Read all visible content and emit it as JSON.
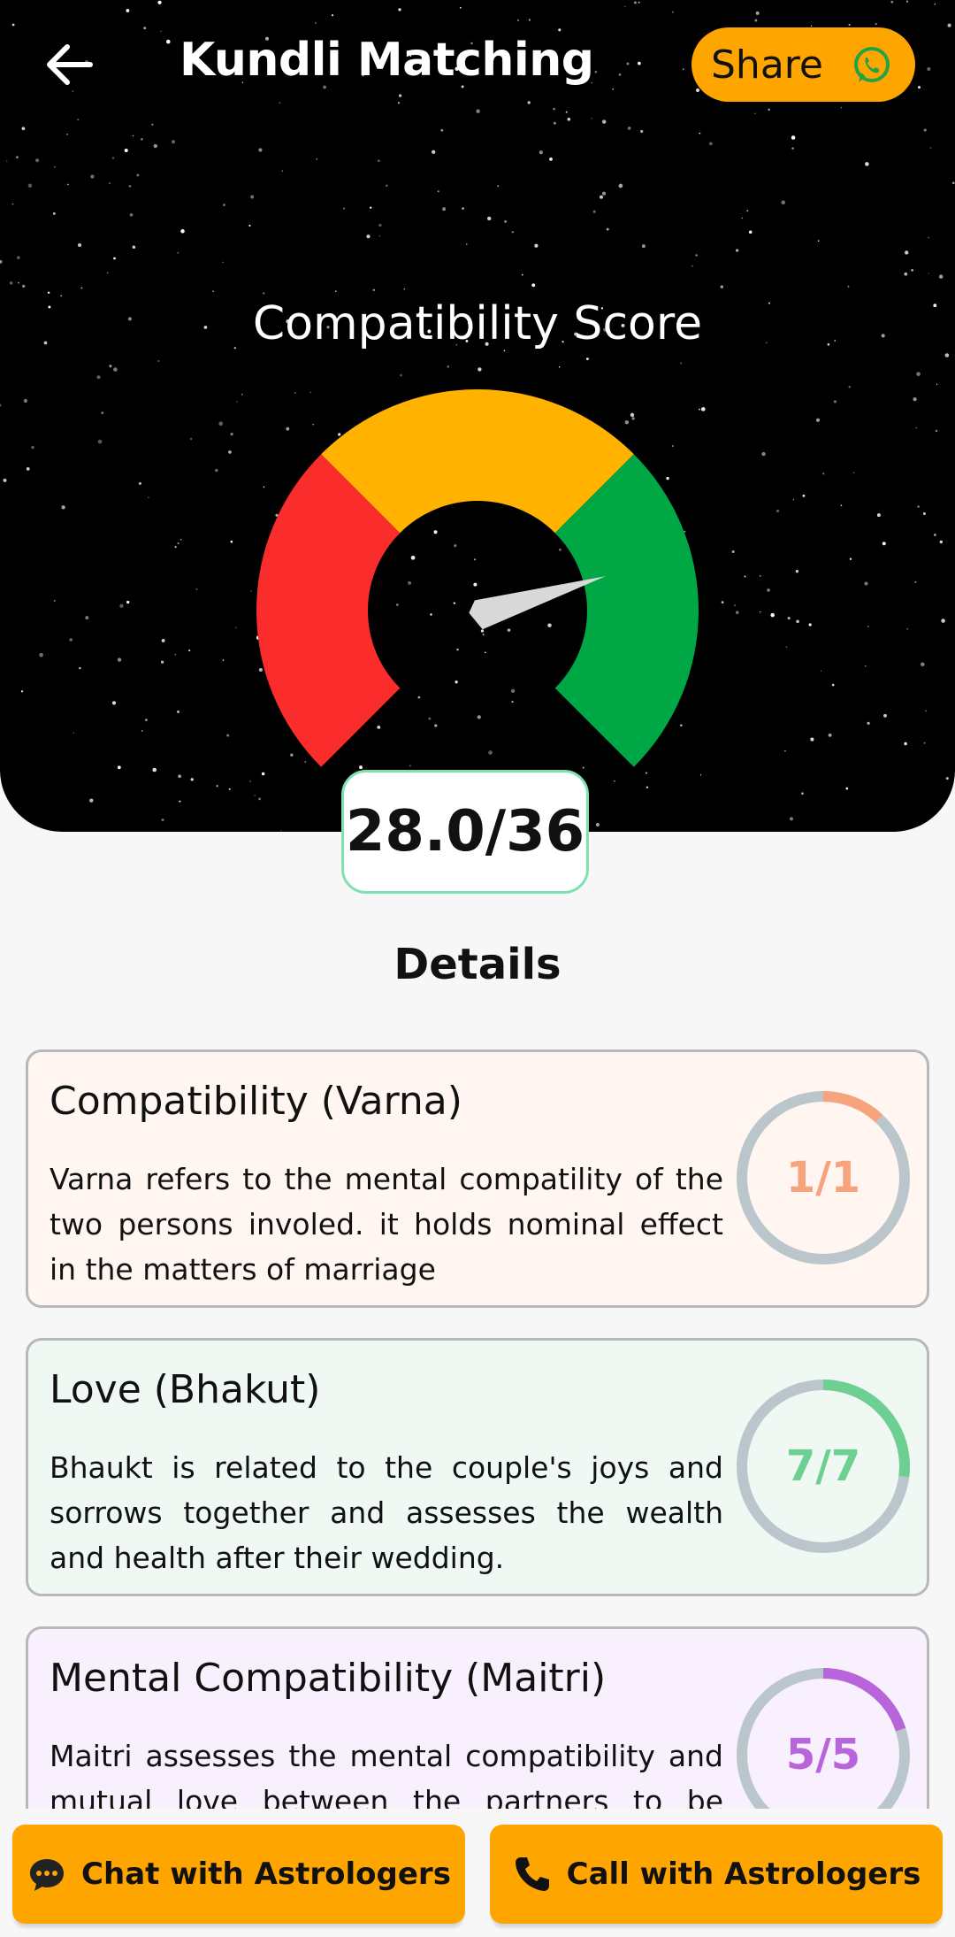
{
  "header": {
    "title": "Kundli Matching",
    "share_label": "Share",
    "back_icon": "arrow-left-icon",
    "share_icon": "whatsapp-icon"
  },
  "gauge": {
    "title": "Compatibility Score",
    "score_text": "28.0/36",
    "score": 28.0,
    "max": 36,
    "segment_colors": [
      "#FB2C2C",
      "#FFB300",
      "#00A745"
    ]
  },
  "details": {
    "title": "Details",
    "cards": [
      {
        "title": "Compatibility (Varna)",
        "description": "Varna refers to the mental compatility of the two persons involed. it holds nominal effect in the matters of marriage",
        "score_label": "1/1",
        "progress": 0.12,
        "bg_color": "#FFF5F1",
        "accent_color": "#F7A47C"
      },
      {
        "title": "Love (Bhakut)",
        "description": "Bhaukt is related to the couple's joys and sorrows together and assesses the wealth and health after their wedding.",
        "score_label": "7/7",
        "progress": 0.27,
        "bg_color": "#EFF8F2",
        "accent_color": "#6ECF93"
      },
      {
        "title": "Mental Compatibility (Maitri)",
        "description": "Maitri assesses the mental compatibility and mutual love between the partners to be married.",
        "score_label": "5/5",
        "progress": 0.2,
        "bg_color": "#F8F0FC",
        "accent_color": "#B865DB"
      }
    ]
  },
  "bottom": {
    "chat_label": "Chat with Astrologers",
    "call_label": "Call with Astrologers",
    "chat_icon": "chat-bubble-icon",
    "call_icon": "phone-icon"
  }
}
